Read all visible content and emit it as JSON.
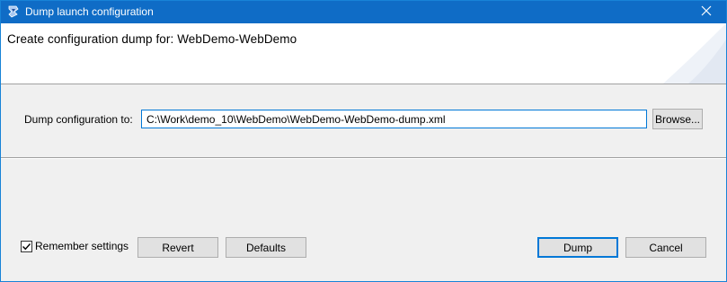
{
  "window": {
    "title": "Dump launch configuration",
    "title_icon": "eclipse-launch-icon",
    "close_icon": "close-icon"
  },
  "header": {
    "title": "Create configuration dump for: WebDemo-WebDemo"
  },
  "dump_field": {
    "label": "Dump configuration to:",
    "value": "C:\\Work\\demo_10\\WebDemo\\WebDemo-WebDemo-dump.xml",
    "browse_label": "Browse..."
  },
  "footer": {
    "remember_label": "Remember settings",
    "remember_checked": true,
    "revert_label": "Revert",
    "defaults_label": "Defaults",
    "dump_label": "Dump",
    "cancel_label": "Cancel"
  },
  "colors": {
    "titlebar": "#0f6cc6",
    "accent": "#0078d7",
    "dialog_bg": "#f0f0f0"
  }
}
